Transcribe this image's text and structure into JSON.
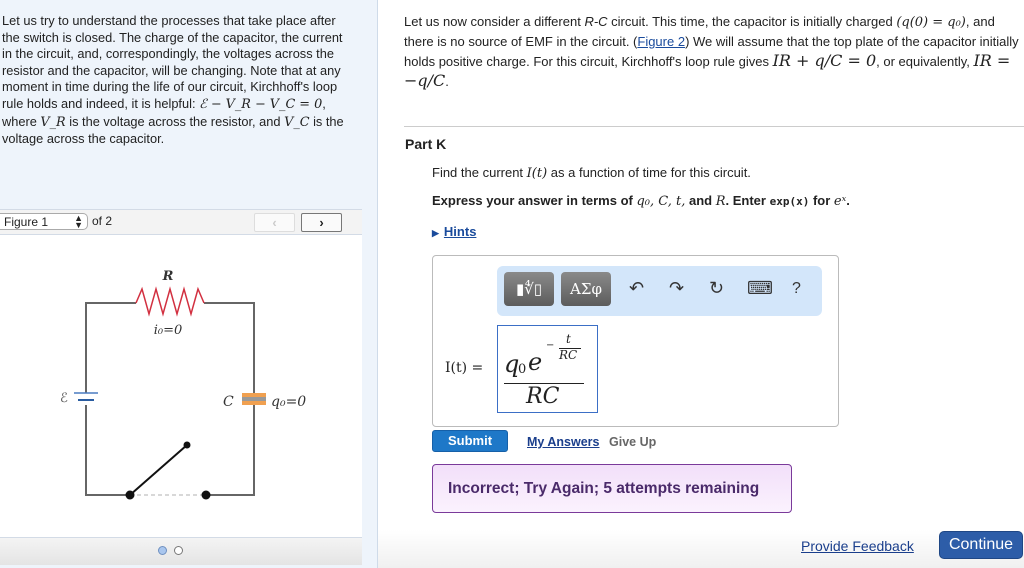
{
  "intro": {
    "p1": "Let us try to understand the processes that take place after the switch is closed. The charge of the capacitor, the current in the circuit, and, correspondingly, the voltages across the resistor and the capacitor, will be changing. Note that at any moment in time during the life of our circuit, Kirchhoff's loop rule holds and indeed, it is helpful: ",
    "eq": "ℰ − V_R − V_C = 0",
    "p2": ", where ",
    "vr": "V_R",
    "p3": " is the voltage across the resistor, and ",
    "vc": "V_C",
    "p4": " is the voltage across the capacitor."
  },
  "figure": {
    "select": "Figure 1",
    "of": "of 2",
    "prev": "‹",
    "next": "›",
    "labels": {
      "R": "R",
      "i0": "i₀=0",
      "emf": "ℰ",
      "C": "C",
      "q0": "q₀=0"
    }
  },
  "problem": {
    "t1": "Let us now consider a different ",
    "rc": "R-C",
    "t2": " circuit. This time, the capacitor is initially charged ",
    "m1": "(q(0) = q₀)",
    "t3": ", and there is no source of EMF in the circuit. (",
    "figlink": "Figure 2",
    "t4": ") We will assume that the top plate of the capacitor initially holds positive charge. For this circuit, Kirchhoff's loop rule gives ",
    "m2": "IR + q/C = 0",
    "t5": ", or equivalently, ",
    "m3": "IR = −q/C",
    "t6": "."
  },
  "part": {
    "title": "Part K",
    "q1a": "Find the current ",
    "q1m": "I(t)",
    "q1b": " as a function of time for this circuit.",
    "q2a": "Express your answer in terms of ",
    "q2m": "q₀, C, t,",
    "q2b": " and ",
    "q2m2": "R",
    "q2c": ". Enter ",
    "q2code": "exp(x)",
    "q2d": " for ",
    "q2m3": "eˣ",
    "q2e": ".",
    "hints": "Hints"
  },
  "toolbar": {
    "templates": "▮∜▯",
    "greek": "ΑΣφ",
    "undo": "↶",
    "redo": "↷",
    "reset": "↻",
    "keyboard": "⌨",
    "help": "?"
  },
  "answer": {
    "label": "I(t) =",
    "num_q": "q",
    "num_sub": "0",
    "num_e": "e",
    "exp_num": "t",
    "exp_den": "RC",
    "den": "RC"
  },
  "actions": {
    "submit": "Submit",
    "my_answers": "My Answers",
    "give_up": "Give Up"
  },
  "feedback": "Incorrect; Try Again; 5 attempts remaining",
  "footer": {
    "provide_feedback": "Provide Feedback",
    "continue": "Continue"
  }
}
